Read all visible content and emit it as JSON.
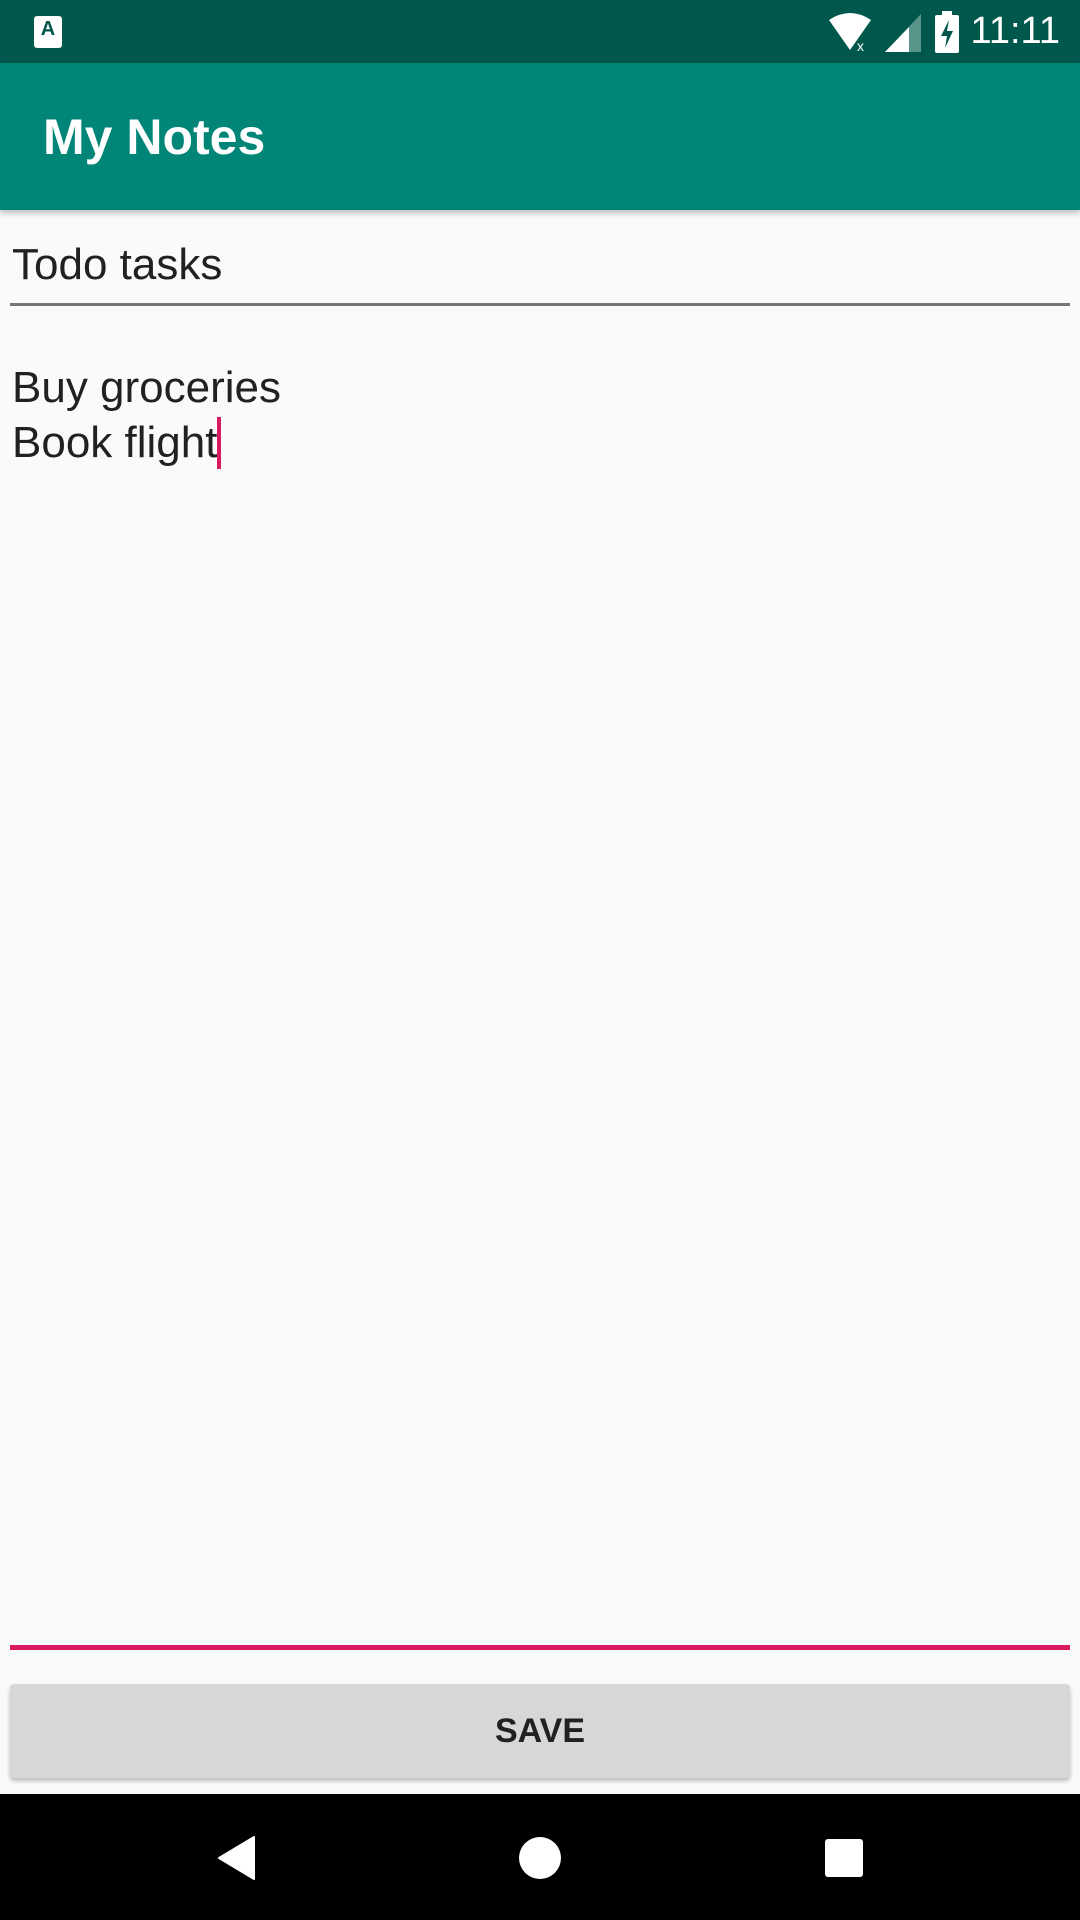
{
  "status_bar": {
    "time": "11:11",
    "app_icon": "A",
    "icons": [
      "wifi-off-icon",
      "signal-icon",
      "battery-charging-icon"
    ]
  },
  "app_bar": {
    "title": "My Notes"
  },
  "note": {
    "title": "Todo tasks",
    "body_lines": [
      "Buy groceries",
      "Book flight"
    ]
  },
  "save_button": {
    "label": "SAVE"
  },
  "colors": {
    "primary": "#008577",
    "primary_dark": "#00574b",
    "accent": "#d81b60"
  }
}
